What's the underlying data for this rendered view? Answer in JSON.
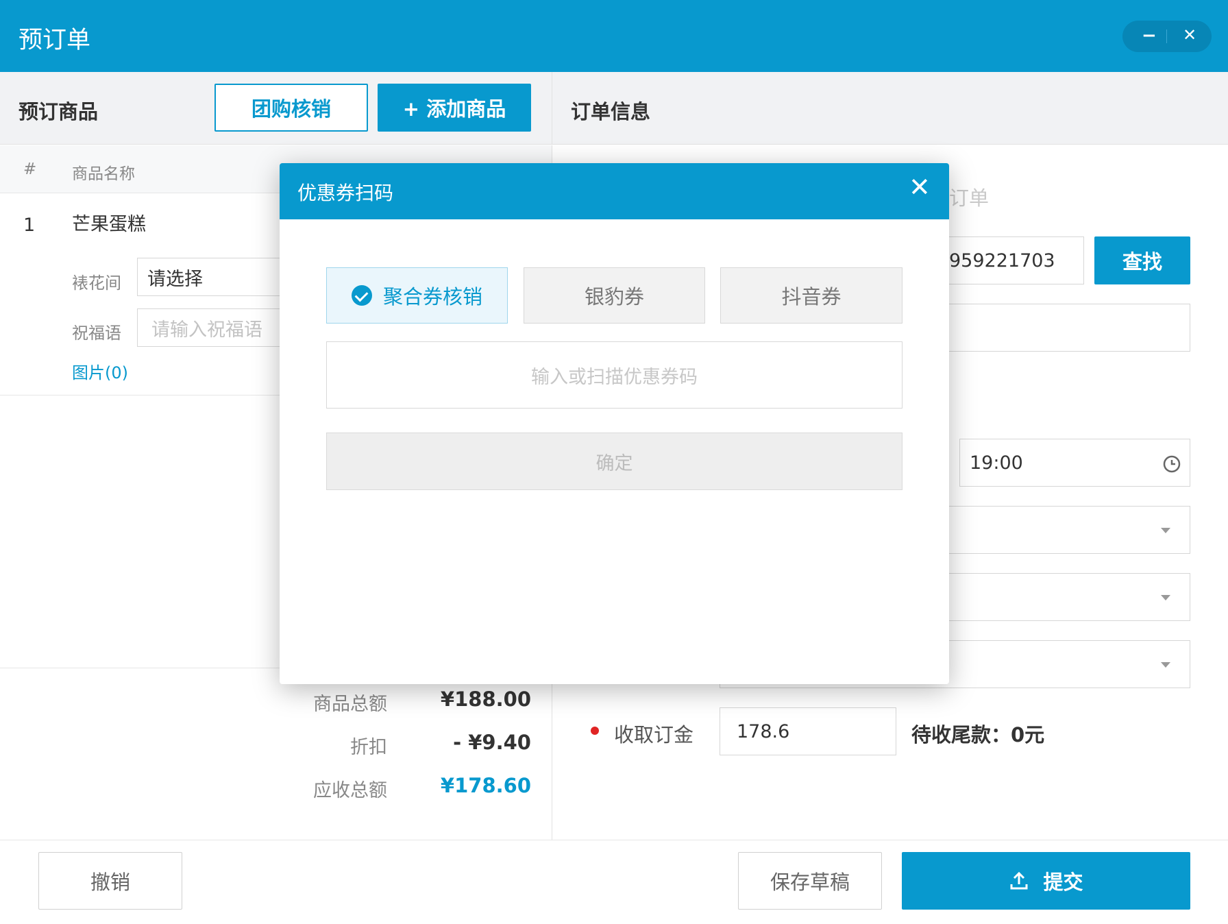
{
  "window": {
    "title": "预订单",
    "minimize_glyph": "−",
    "close_glyph": "✕"
  },
  "left_panel": {
    "header": "预订商品",
    "group_buy_button": "团购核销",
    "add_product_button": "+ 添加商品",
    "table_headers": {
      "index": "#",
      "name": "商品名称"
    },
    "rows": [
      {
        "index": "1",
        "name": "芒果蛋糕",
        "flower_label": "裱花间",
        "flower_value": "请选择",
        "blessing_label": "祝福语",
        "blessing_placeholder": "请输入祝福语",
        "images_link": "图片(0)"
      }
    ],
    "totals": {
      "subtotal_label": "商品总额",
      "subtotal_value": "¥188.00",
      "discount_label": "折扣",
      "discount_value": "- ¥9.40",
      "receivable_label": "应收总额",
      "receivable_value": "¥178.60"
    }
  },
  "right_panel": {
    "header": "订单信息",
    "partial_label": "订单",
    "phone_value": "959221703",
    "search_button": "查找",
    "time_value": "19:00",
    "deposit_label": "收取订金",
    "deposit_value": "178.6",
    "balance_text": "待收尾款：0元"
  },
  "footer": {
    "cancel_button": "撤销",
    "save_draft_button": "保存草稿",
    "submit_button": "提交"
  },
  "modal": {
    "title": "优惠券扫码",
    "close_glyph": "✕",
    "tabs": [
      {
        "label": "聚合券核销",
        "active": true
      },
      {
        "label": "银豹券",
        "active": false
      },
      {
        "label": "抖音券",
        "active": false
      }
    ],
    "coupon_placeholder": "输入或扫描优惠券码",
    "confirm_button": "确定"
  },
  "colors": {
    "primary": "#0899ce",
    "danger_dot": "#e02424"
  }
}
